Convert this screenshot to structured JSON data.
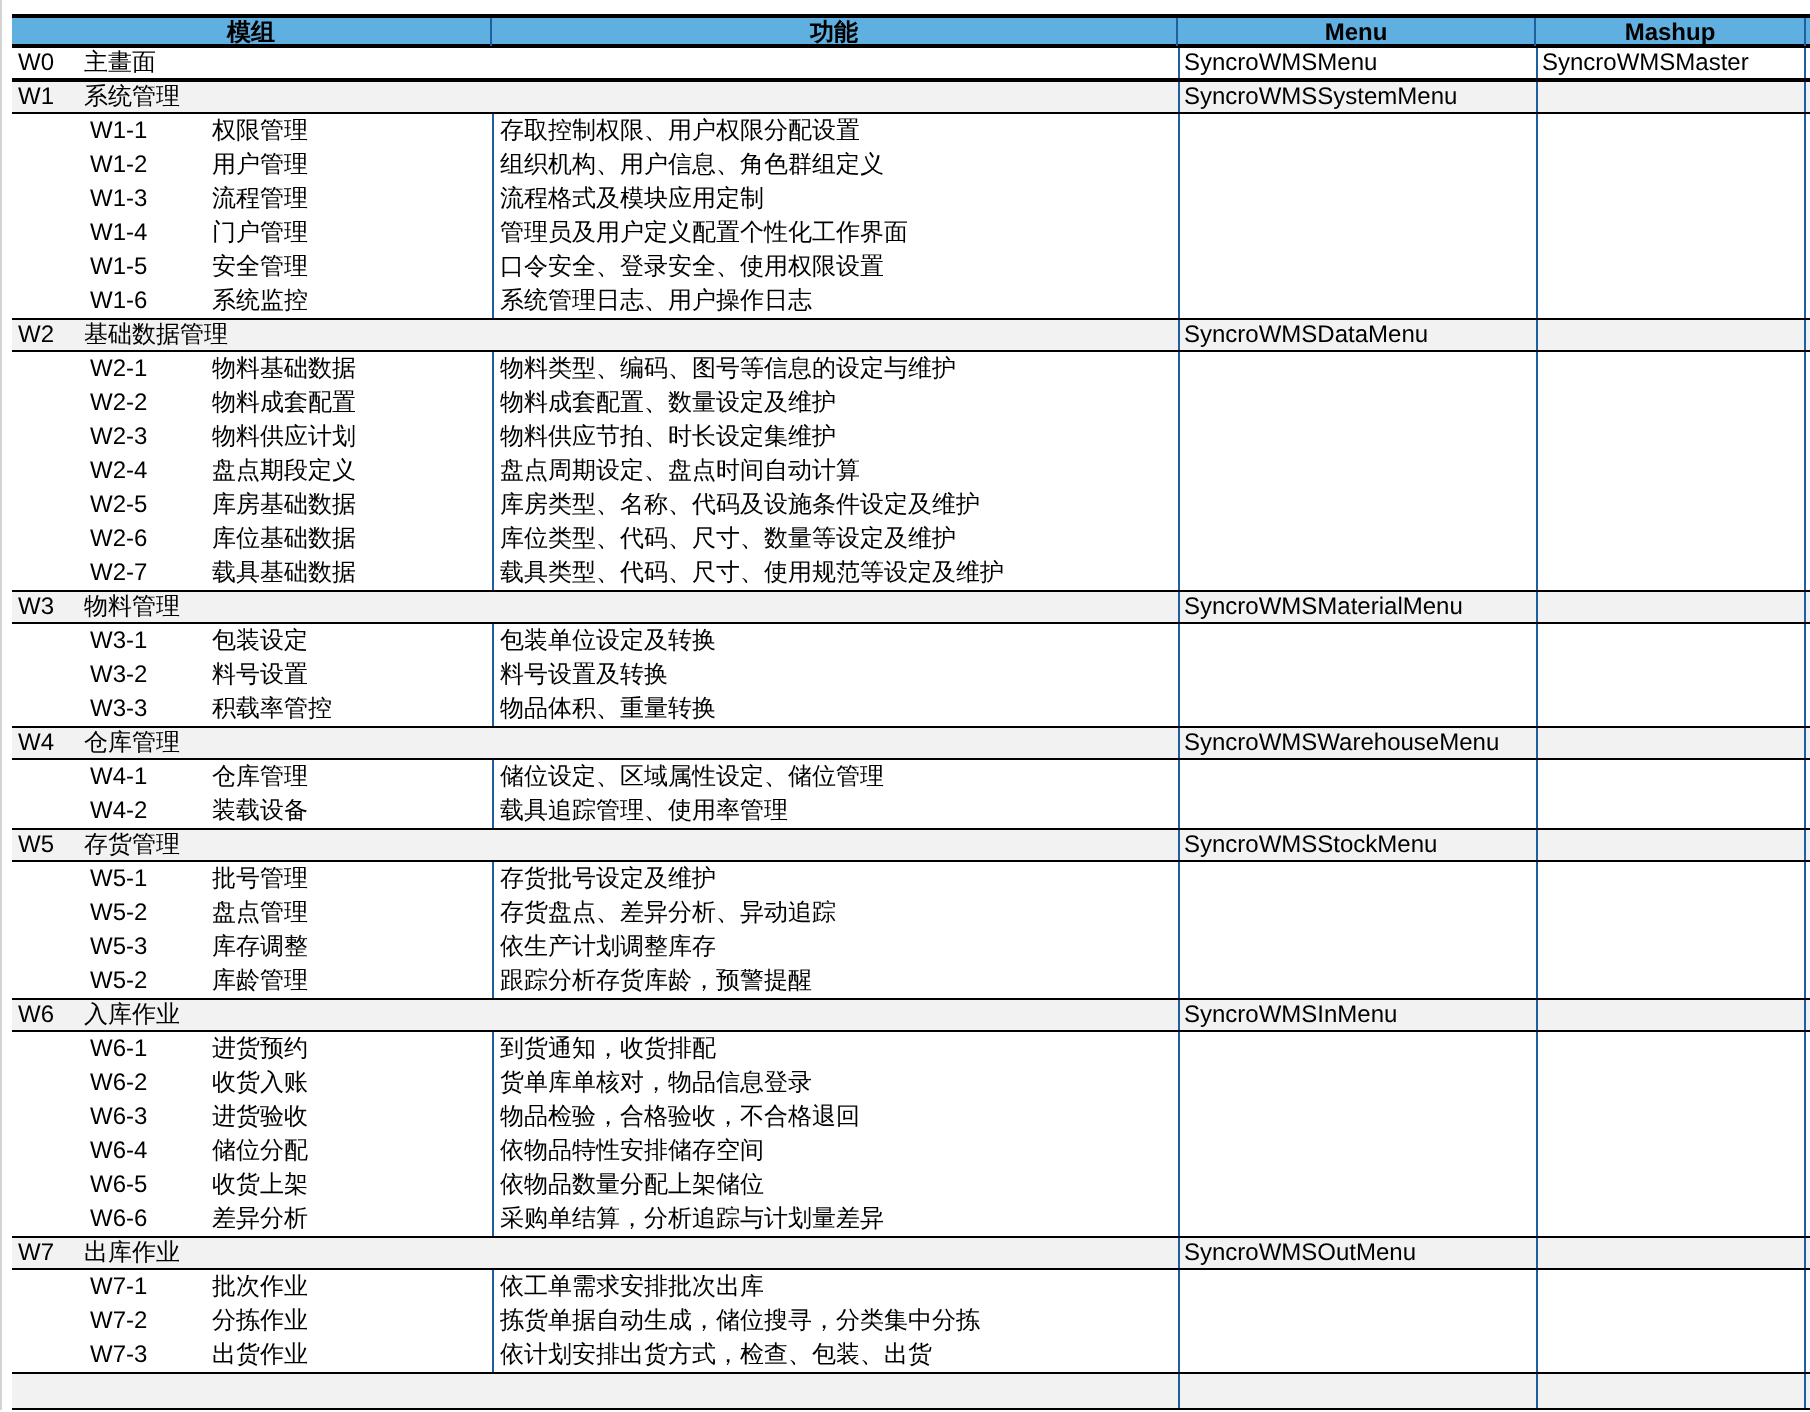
{
  "table": {
    "columns": [
      "模组",
      "功能",
      "Menu",
      "Mashup"
    ],
    "groups": [
      {
        "code": "W0",
        "name": "主畫面",
        "menu": "SyncroWMSMenu",
        "mashup": "SyncroWMSMaster"
      },
      {
        "code": "W1",
        "name": "系统管理",
        "menu": "SyncroWMSSystemMenu",
        "children": [
          {
            "code": "W1-1",
            "name": "权限管理",
            "function": "存取控制权限、用户权限分配设置"
          },
          {
            "code": "W1-2",
            "name": "用户管理",
            "function": "组织机构、用户信息、角色群组定义"
          },
          {
            "code": "W1-3",
            "name": "流程管理",
            "function": "流程格式及模块应用定制"
          },
          {
            "code": "W1-4",
            "name": "门户管理",
            "function": "管理员及用户定义配置个性化工作界面"
          },
          {
            "code": "W1-5",
            "name": "安全管理",
            "function": "口令安全、登录安全、使用权限设置"
          },
          {
            "code": "W1-6",
            "name": "系统监控",
            "function": "系统管理日志、用户操作日志"
          }
        ]
      },
      {
        "code": "W2",
        "name": "基础数据管理",
        "menu": "SyncroWMSDataMenu",
        "children": [
          {
            "code": "W2-1",
            "name": "物料基础数据",
            "function": "物料类型、编码、图号等信息的设定与维护"
          },
          {
            "code": "W2-2",
            "name": "物料成套配置",
            "function": "物料成套配置、数量设定及维护"
          },
          {
            "code": "W2-3",
            "name": "物料供应计划",
            "function": "物料供应节拍、时长设定集维护"
          },
          {
            "code": "W2-4",
            "name": "盘点期段定义",
            "function": "盘点周期设定、盘点时间自动计算"
          },
          {
            "code": "W2-5",
            "name": "库房基础数据",
            "function": "库房类型、名称、代码及设施条件设定及维护"
          },
          {
            "code": "W2-6",
            "name": "库位基础数据",
            "function": "库位类型、代码、尺寸、数量等设定及维护"
          },
          {
            "code": "W2-7",
            "name": "载具基础数据",
            "function": "载具类型、代码、尺寸、使用规范等设定及维护"
          }
        ]
      },
      {
        "code": "W3",
        "name": "物料管理",
        "menu": "SyncroWMSMaterialMenu",
        "children": [
          {
            "code": "W3-1",
            "name": "包装设定",
            "function": "包装单位设定及转换"
          },
          {
            "code": "W3-2",
            "name": "料号设置",
            "function": "料号设置及转换"
          },
          {
            "code": "W3-3",
            "name": "积载率管控",
            "function": "物品体积、重量转换"
          }
        ]
      },
      {
        "code": "W4",
        "name": "仓库管理",
        "menu": "SyncroWMSWarehouseMenu",
        "children": [
          {
            "code": "W4-1",
            "name": "仓库管理",
            "function": "储位设定、区域属性设定、储位管理"
          },
          {
            "code": "W4-2",
            "name": "装载设备",
            "function": "载具追踪管理、使用率管理"
          }
        ]
      },
      {
        "code": "W5",
        "name": "存货管理",
        "menu": "SyncroWMSStockMenu",
        "children": [
          {
            "code": "W5-1",
            "name": "批号管理",
            "function": "存货批号设定及维护"
          },
          {
            "code": "W5-2",
            "name": "盘点管理",
            "function": "存货盘点、差异分析、异动追踪"
          },
          {
            "code": "W5-3",
            "name": "库存调整",
            "function": "依生产计划调整库存"
          },
          {
            "code": "W5-2",
            "name": "库龄管理",
            "function": "跟踪分析存货库龄，预警提醒"
          }
        ]
      },
      {
        "code": "W6",
        "name": "入库作业",
        "menu": "SyncroWMSInMenu",
        "children": [
          {
            "code": "W6-1",
            "name": "进货预约",
            "function": "到货通知，收货排配"
          },
          {
            "code": "W6-2",
            "name": "收货入账",
            "function": "货单库单核对，物品信息登录"
          },
          {
            "code": "W6-3",
            "name": "进货验收",
            "function": "物品检验，合格验收，不合格退回"
          },
          {
            "code": "W6-4",
            "name": "储位分配",
            "function": "依物品特性安排储存空间"
          },
          {
            "code": "W6-5",
            "name": "收货上架",
            "function": "依物品数量分配上架储位"
          },
          {
            "code": "W6-6",
            "name": "差异分析",
            "function": "采购单结算，分析追踪与计划量差异"
          }
        ]
      },
      {
        "code": "W7",
        "name": "出库作业",
        "menu": "SyncroWMSOutMenu",
        "children": [
          {
            "code": "W7-1",
            "name": "批次作业",
            "function": "依工单需求安排批次出库"
          },
          {
            "code": "W7-2",
            "name": "分拣作业",
            "function": "拣货单据自动生成，储位搜寻，分类集中分拣"
          },
          {
            "code": "W7-3",
            "name": "出货作业",
            "function": "依计划安排出货方式，检查、包装、出货"
          }
        ]
      }
    ]
  }
}
